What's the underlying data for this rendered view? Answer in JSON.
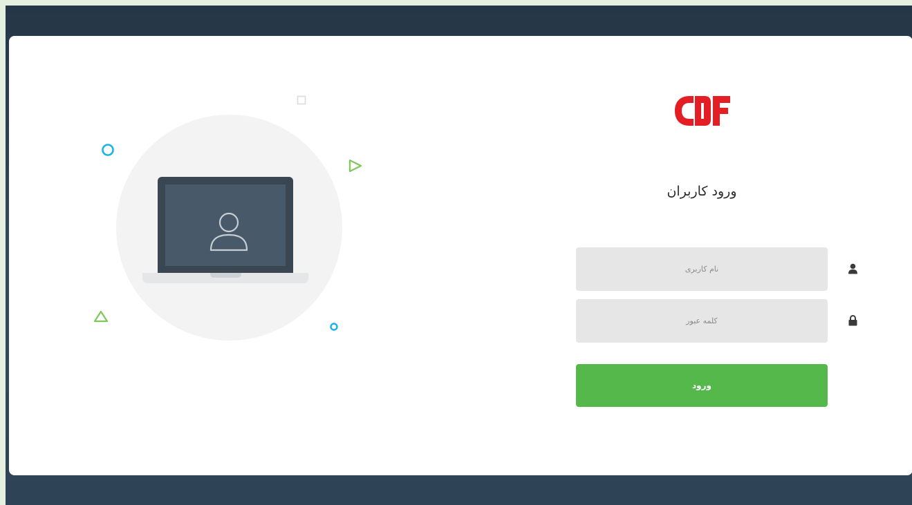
{
  "brand": {
    "logo_icon": "cdf-logo",
    "color": "#e31e24"
  },
  "login": {
    "title": "ورود کاربران",
    "username": {
      "placeholder": "نام کاربری",
      "value": "",
      "icon": "user-icon"
    },
    "password": {
      "placeholder": "کلمه عبور",
      "value": "",
      "icon": "lock-icon"
    },
    "submit_label": "ورود"
  },
  "illustration": {
    "icon": "user-avatar-icon",
    "device": "laptop"
  },
  "colors": {
    "accent": "#55b84a",
    "backdrop": "#2e4356",
    "outer": "#e6f0e1",
    "decor_blue": "#1ab3e8",
    "decor_green": "#7dc95a"
  }
}
